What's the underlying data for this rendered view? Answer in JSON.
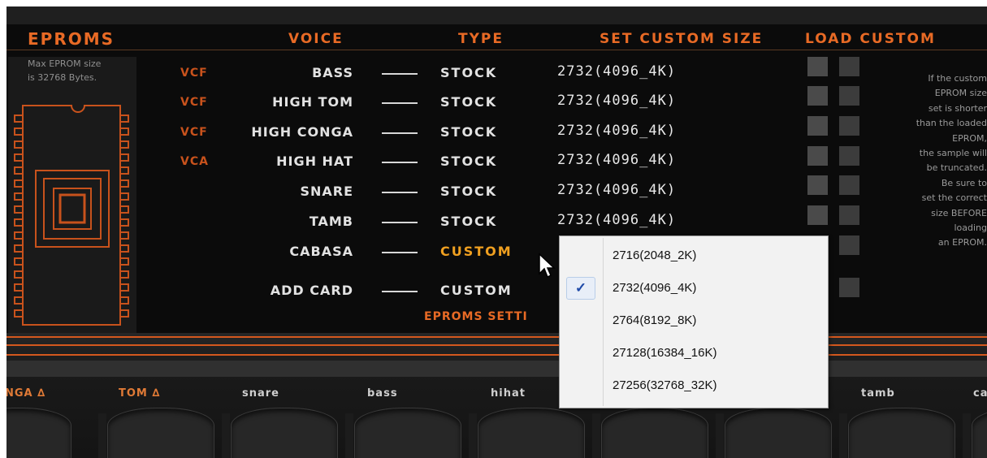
{
  "headers": {
    "eproms": "EPROMS",
    "voice": "VOICE",
    "type": "TYPE",
    "set_custom_size": "SET CUSTOM SIZE",
    "load_custom": "LOAD CUSTOM"
  },
  "chip_note": "Max EPROM size\nis 32768 Bytes.",
  "rows": [
    {
      "prefix": "VCF",
      "voice": "BASS",
      "type": "STOCK",
      "size": "2732(4096_4K)"
    },
    {
      "prefix": "VCF",
      "voice": "HIGH TOM",
      "type": "STOCK",
      "size": "2732(4096_4K)"
    },
    {
      "prefix": "VCF",
      "voice": "HIGH CONGA",
      "type": "STOCK",
      "size": "2732(4096_4K)"
    },
    {
      "prefix": "VCA",
      "voice": "HIGH HAT",
      "type": "STOCK",
      "size": "2732(4096_4K)"
    },
    {
      "prefix": "",
      "voice": "SNARE",
      "type": "STOCK",
      "size": "2732(4096_4K)"
    },
    {
      "prefix": "",
      "voice": "TAMB",
      "type": "STOCK",
      "size": "2732(4096_4K)"
    },
    {
      "prefix": "",
      "voice": "CABASA",
      "type": "CUSTOM",
      "size": ""
    },
    {
      "prefix": "",
      "voice": "ADD CARD",
      "type": "CUSTOM",
      "size": ""
    }
  ],
  "help_text": "If the custom\nEPROM size\nset is shorter\nthan the loaded\nEPROM,\nthe sample will\nbe truncated.\nBe sure to\nset the correct\nsize BEFORE\nloading\nan EPROM.",
  "settings_label": "EPROMS SETTI",
  "pads": [
    "NGA ∆",
    "TOM ∆",
    "snare",
    "bass",
    "hihat",
    "tamb",
    "ca"
  ],
  "dropdown": {
    "options": [
      "2716(2048_2K)",
      "2732(4096_4K)",
      "2764(8192_8K)",
      "27128(16384_16K)",
      "27256(32768_32K)"
    ],
    "selected_index": 1,
    "check_mark": "✓"
  },
  "colors": {
    "accent": "#e86a25",
    "custom": "#f0a020",
    "background": "#0b0b0b"
  }
}
